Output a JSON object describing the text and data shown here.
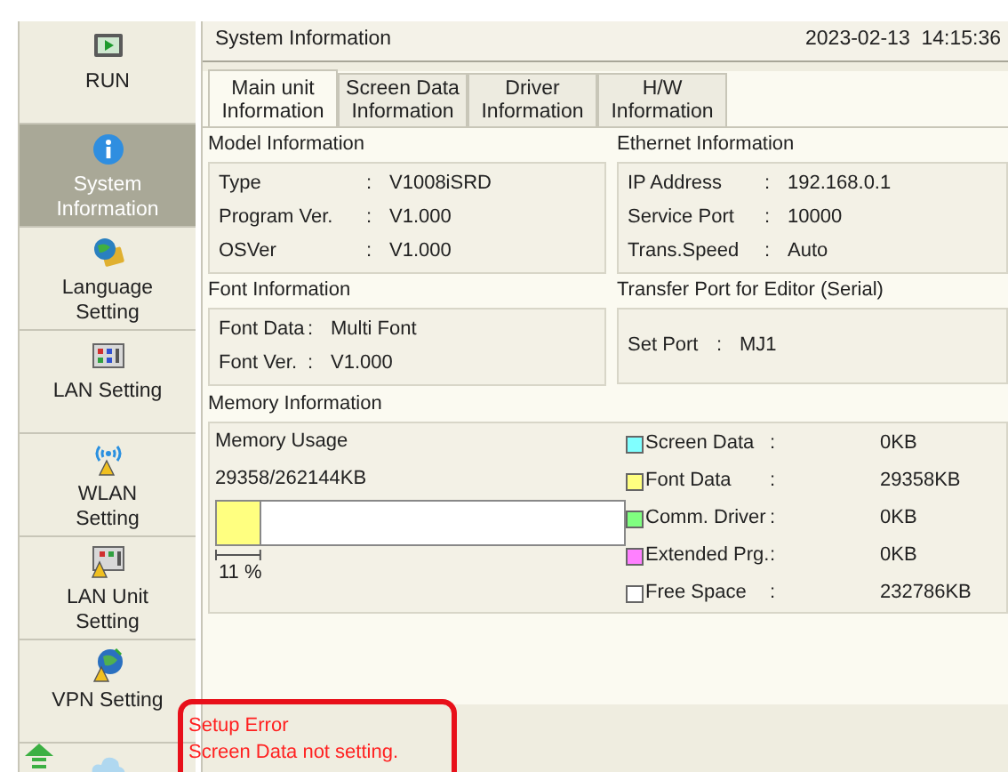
{
  "sidebar": {
    "items": [
      {
        "label": "RUN",
        "kind": "run",
        "selected": false
      },
      {
        "label": "System Information",
        "kind": "info",
        "selected": true
      },
      {
        "label": "Language Setting",
        "kind": "language",
        "selected": false
      },
      {
        "label": "LAN Setting",
        "kind": "lan",
        "selected": false
      },
      {
        "label": "WLAN Setting",
        "kind": "wlan",
        "selected": false
      },
      {
        "label": "LAN Unit Setting",
        "kind": "lanunit",
        "selected": false
      },
      {
        "label": "VPN Setting",
        "kind": "vpn",
        "selected": false
      }
    ]
  },
  "header": {
    "title": "System Information",
    "datetime": "2023-02-13  14:15:36"
  },
  "tabs": [
    {
      "label": "Main unit Information",
      "selected": true
    },
    {
      "label": "Screen Data Information",
      "selected": false
    },
    {
      "label": "Driver Information",
      "selected": false
    },
    {
      "label": "H/W Information",
      "selected": false
    }
  ],
  "model_information": {
    "title": "Model Information",
    "rows": [
      {
        "label": "Type",
        "colon": ":",
        "value": "V1008iSRD"
      },
      {
        "label": "Program Ver.",
        "colon": ":",
        "value": "V1.000"
      },
      {
        "label": "OSVer",
        "colon": ":",
        "value": "V1.000"
      }
    ]
  },
  "ethernet_information": {
    "title": "Ethernet Information",
    "rows": [
      {
        "label": "IP Address",
        "colon": ":",
        "value": "192.168.0.1"
      },
      {
        "label": "Service Port",
        "colon": ":",
        "value": "10000"
      },
      {
        "label": "Trans.Speed",
        "colon": ":",
        "value": "Auto"
      }
    ]
  },
  "font_information": {
    "title": "Font Information",
    "rows": [
      {
        "label": "Font Data",
        "colon": ":",
        "value": "Multi Font"
      },
      {
        "label": "Font Ver.",
        "colon": ":",
        "value": "V1.000"
      }
    ]
  },
  "transfer_port": {
    "title": "Transfer Port for Editor (Serial)",
    "rows": [
      {
        "label": "Set Port",
        "colon": ":",
        "value": "MJ1"
      }
    ]
  },
  "memory_information": {
    "title": "Memory Information",
    "usage_label": "Memory Usage",
    "usage": "29358/262144KB",
    "level": 0.11,
    "percent": "11 %",
    "legend": [
      {
        "label": "Screen Data",
        "colon": ":",
        "value": "0KB",
        "color": "#80ffff"
      },
      {
        "label": "Font Data",
        "colon": ":",
        "value": "29358KB",
        "color": "#ffff80"
      },
      {
        "label": "Comm. Driver",
        "colon": ":",
        "value": "0KB",
        "color": "#80ff80"
      },
      {
        "label": "Extended Prg.",
        "colon": ":",
        "value": "0KB",
        "color": "#ff80ff"
      },
      {
        "label": "Free Space",
        "colon": ":",
        "value": "232786KB",
        "color": "#ffffff"
      }
    ]
  },
  "error": {
    "title": "Setup Error",
    "message": "Screen Data not setting."
  }
}
